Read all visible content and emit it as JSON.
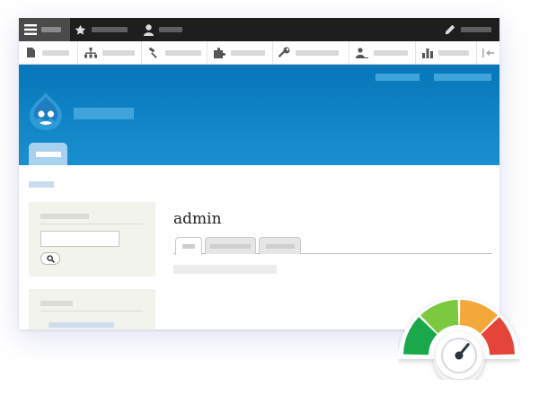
{
  "page": {
    "title": "admin"
  },
  "toolbar": {
    "menu_icon": "hamburger-icon",
    "shortcuts_icon": "star-icon",
    "user_icon": "person-icon",
    "edit_icon": "pencil-icon"
  },
  "tray": {
    "icons": [
      "content-icon",
      "structure-icon",
      "appearance-icon",
      "extend-icon",
      "configuration-icon",
      "people-icon",
      "reports-icon",
      "collapse-icon"
    ]
  },
  "search": {
    "value": "",
    "button_icon": "magnifier-icon"
  },
  "gauge": {
    "level": 0.72,
    "colors": [
      "#1aa84a",
      "#7cc83f",
      "#f2a93a",
      "#e5443b"
    ],
    "needle_color": "#2d3540"
  },
  "colors": {
    "toolbar_bg": "#1e1e1e",
    "header_bg": "#0677b8",
    "sidebar_bg": "#f3f3ee"
  }
}
